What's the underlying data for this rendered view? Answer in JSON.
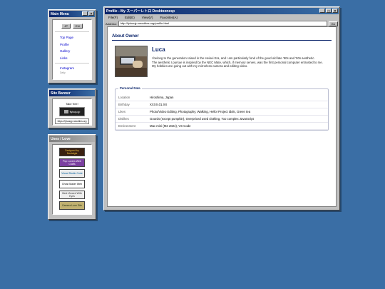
{
  "main_menu": {
    "title": "Main Menu",
    "lang_jp": "JP",
    "lang_en": "EN",
    "links": [
      "Top Page",
      "Profile",
      "Gallery",
      "Links",
      "Instagram"
    ],
    "footnote": "Daily"
  },
  "site_banner": {
    "title": "Site Banner",
    "caption": "Take free!",
    "banner_label": "flylouju.jp",
    "url": "https://fyluoujp.neocities.org"
  },
  "uses_love": {
    "title": "Uses / Love",
    "badges": [
      "Designed by Nostalgia",
      "Pop Lovers Web Crafts",
      "Visual Studio Code",
      "Ghost Maker Web",
      "Best Viewed With Eyes",
      "Camera Love Site"
    ]
  },
  "browser": {
    "title": "Profile - My スーパーレトロ Desktoonesp",
    "menu": [
      "File(F)",
      "Edit(E)",
      "View(V)",
      "Favorites(A)"
    ],
    "address_label": "Address:",
    "address_value": "http://fyluoujp.neocities.org/profile.html",
    "go_label": "Go"
  },
  "profile": {
    "section_title": "About Owner",
    "name": "Luca",
    "bio": [
      "I belong to the generation raised in the Heisei Era, and I am particularly fond of the good old late '90s and '00s aesthetic.",
      "The aesthetic I pursue is inspired by the NEC Mate, which, if memory serves, was the first personal computer entrusted to me.",
      "My hobbies are going out with my mirrorless camera and editing video."
    ],
    "personal_title": "Personal Data",
    "rows": [
      {
        "key": "Location",
        "value": "Hiroshima, Japan"
      },
      {
        "key": "Birthday",
        "value": "XXXX.01.XX"
      },
      {
        "key": "Likes",
        "value": "Photo/Video Editing, Photography, Walking, Hello! Project idols, Green tea"
      },
      {
        "key": "Dislikes",
        "value": "Gourds (except pumpkin), Overpriced used clothing, Too complex JavaScript"
      },
      {
        "key": "Environment",
        "value": "Mac mini (M4 2024), VS Code"
      }
    ]
  },
  "colors": {
    "desktop": "#3a6ea5",
    "title_active": "#0a246a",
    "link": "#0000cc"
  }
}
